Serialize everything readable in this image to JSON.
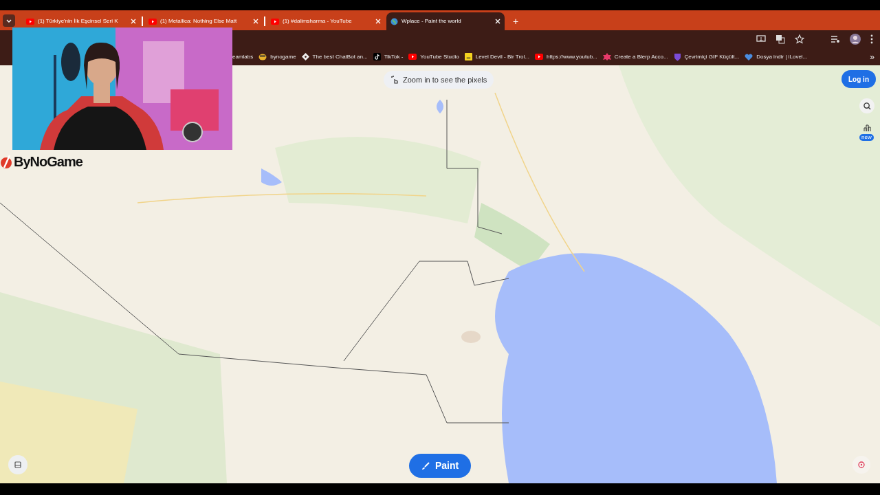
{
  "tabs": [
    {
      "title": "(1) Türkiye'nin İlk Eşcinsel Seri K",
      "selected": false
    },
    {
      "title": "(1) Metallica: Nothing Else Matt",
      "selected": false
    },
    {
      "title": "(1) #dalimsharma - YouTube",
      "selected": false
    },
    {
      "title": "Wplace - Paint the world",
      "selected": true
    }
  ],
  "new_tab": "+",
  "bookmarks": [
    "eamlabs",
    "bynogame",
    "The best ChatBot an...",
    "TikTok -",
    "YouTube Studio",
    "Level Devil - Bir Trol...",
    "https://www.youtub...",
    "Create a Blerp Acco...",
    "Çevrimiçi GIF Küçült...",
    "Dosya indir | iLovel..."
  ],
  "bookmarks_more": "»",
  "overlay_logo": "ByNoGame",
  "map": {
    "kind": "picture",
    "hint": "Zoom in to see the pixels",
    "login": "Log in",
    "badge": "new",
    "paint": "Paint"
  }
}
